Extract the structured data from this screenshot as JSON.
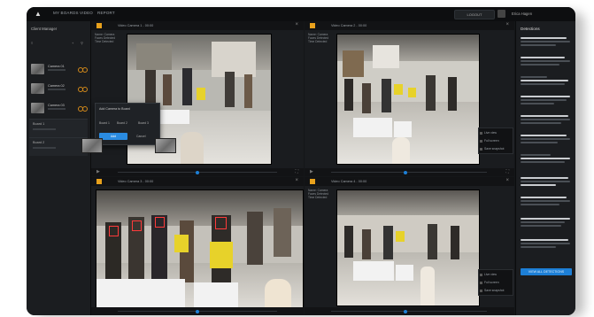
{
  "topbar": {
    "nav": [
      "MY BOARDS",
      "VIDEO",
      "REPORT"
    ],
    "action_button": "LOGOUT",
    "user_name": "Erica Hagen"
  },
  "sidebar": {
    "title": "Client Manager",
    "tools": [
      "≡",
      "+",
      "⚲"
    ],
    "items": [
      {
        "label": "Camera 01"
      },
      {
        "label": "Camera 02"
      },
      {
        "label": "Camera 03"
      }
    ],
    "groups": [
      {
        "label": "Board 1"
      },
      {
        "label": "Board 2"
      }
    ]
  },
  "panes": [
    {
      "name": "Video Camera 1 - 00:00",
      "meta": [
        "Name: Camera",
        "Faces Detected",
        "Time Detected"
      ]
    },
    {
      "name": "Video Camera 2 - 00:00",
      "meta": [
        "Name: Camera",
        "Faces Detected",
        "Time Detected"
      ]
    },
    {
      "name": "Video Camera 3 - 00:00",
      "meta": [
        "Name: Camera",
        "Faces Detected",
        "Time Detected"
      ]
    },
    {
      "name": "Video Camera 4 - 00:00",
      "meta": [
        "Name: Camera",
        "Faces Detected",
        "Time Detected"
      ]
    }
  ],
  "popup": {
    "title": "Add Camera to Board",
    "options": [
      "Board 1",
      "Board 2",
      "Board 3"
    ],
    "primary": "Add",
    "secondary": "Cancel"
  },
  "context_menus": [
    {
      "items": [
        "Live view",
        "Full screen",
        "Save snapshot"
      ]
    },
    {
      "items": [
        "Live view",
        "Full screen",
        "Save snapshot"
      ]
    }
  ],
  "right_panel": {
    "title": "Detections",
    "button": "VIEW ALL DETECTIONS"
  },
  "colors": {
    "accent": "#1d7fd6",
    "camera_tag": "#e8a11c",
    "detection_box": "#ff3b3b"
  }
}
